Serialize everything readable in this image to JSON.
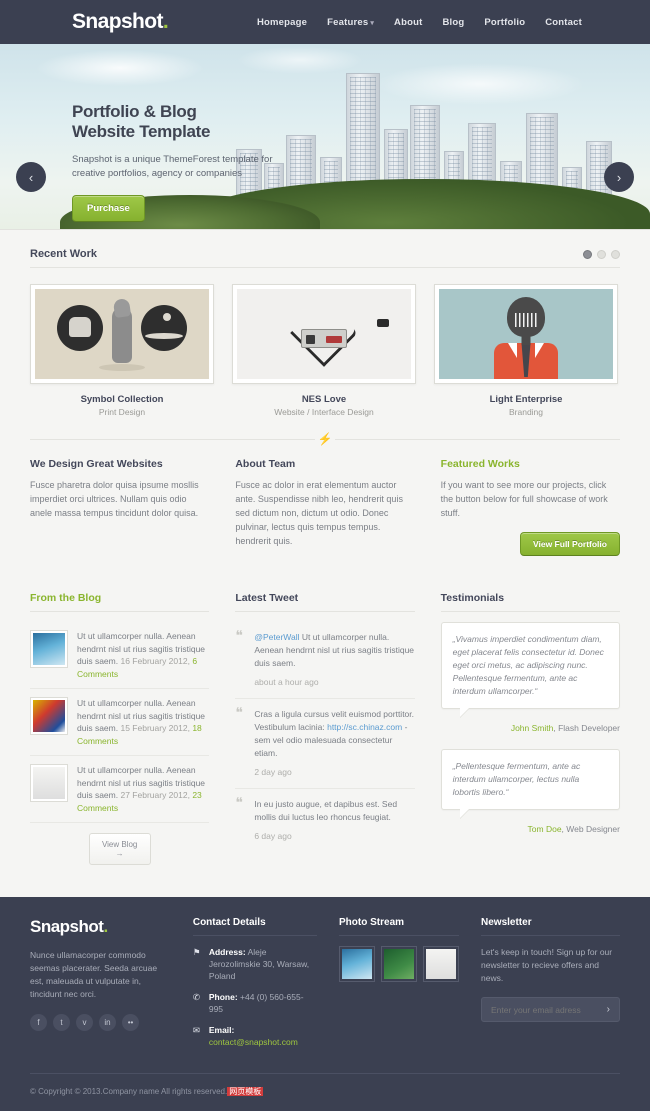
{
  "header": {
    "logo": "Snapshot",
    "logo_dot": ".",
    "nav": [
      {
        "label": "Homepage",
        "caret": ""
      },
      {
        "label": "Features",
        "caret": "▾"
      },
      {
        "label": "About",
        "caret": ""
      },
      {
        "label": "Blog",
        "caret": ""
      },
      {
        "label": "Portfolio",
        "caret": ""
      },
      {
        "label": "Contact",
        "caret": ""
      }
    ]
  },
  "hero": {
    "title_line1": "Portfolio & Blog",
    "title_line2": "Website Template",
    "paragraph": "Snapshot is a unique ThemeForest template for creative portfolios, agency or companies",
    "cta_label": "Purchase",
    "prev_icon": "‹",
    "next_icon": "›"
  },
  "recent_work": {
    "heading": "Recent Work",
    "pagination": [
      "active",
      "inactive",
      "inactive"
    ],
    "items": [
      {
        "title": "Symbol Collection",
        "subtitle": "Print Design"
      },
      {
        "title": "NES Love",
        "subtitle": "Website / Interface Design"
      },
      {
        "title": "Light Enterprise",
        "subtitle": "Branding"
      }
    ]
  },
  "divider_icon": "⚡",
  "columns": [
    {
      "heading": "We Design Great Websites",
      "body": "Fusce pharetra dolor quisa ipsume mosllis imperdiet orci ultrices. Nullam quis odio anele massa tempus tincidunt dolor quisa.",
      "button": ""
    },
    {
      "heading": "About Team",
      "body": "Fusce ac dolor in erat elementum auctor ante. Suspendisse nibh leo, hendrerit quis sed dictum non, dictum ut odio. Donec pulvinar, lectus quis tempus tempus. hendrerit quis.",
      "button": ""
    },
    {
      "heading": "Featured Works",
      "body": "If you want to see more our projects, click the button below for full showcase of work stuff.",
      "button": "View Full Portfolio"
    }
  ],
  "blog": {
    "heading": "From the Blog",
    "posts": [
      {
        "text": "Ut ut ullamcorper nulla. Aenean hendrnt nisl ut rius sagitis tristique duis saem.",
        "date": "16 February 2012,",
        "comments": "6 Comments"
      },
      {
        "text": "Ut ut ullamcorper nulla. Aenean hendrnt nisl ut rius sagitis tristique duis saem.",
        "date": "15 February 2012,",
        "comments": "18 Comments"
      },
      {
        "text": "Ut ut ullamcorper nulla. Aenean hendrnt nisl ut rius sagitis tristique duis saem.",
        "date": "27 February 2012,",
        "comments": "23 Comments"
      }
    ],
    "view_button": "View Blog →"
  },
  "tweets": {
    "heading": "Latest Tweet",
    "items": [
      {
        "handle": "@PeterWall",
        "text": " Ut ut ullamcorper nulla. Aenean hendrnt nisl ut rius sagitis tristique duis saem.",
        "link": "",
        "tail": "",
        "ago": "about a hour ago"
      },
      {
        "handle": "",
        "text": "Cras a ligula cursus velit euismod porttitor. Vestibulum lacinia: ",
        "link": "http://sc.chinaz.com",
        "tail": " - sem vel odio malesuada consectetur etiam.",
        "ago": "2 day ago"
      },
      {
        "handle": "",
        "text": "In eu justo augue, et dapibus est. Sed mollis dui luctus leo rhoncus feugiat.",
        "link": "",
        "tail": "",
        "ago": "6 day ago"
      }
    ]
  },
  "testimonials": {
    "heading": "Testimonials",
    "items": [
      {
        "quote": "„Vivamus imperdiet condimentum diam, eget placerat felis consectetur id. Donec eget orci metus, ac adipiscing nunc. Pellentesque fermentum, ante ac interdum ullamcorper.“",
        "author": "John Smith",
        "role": ", Flash Developer"
      },
      {
        "quote": "„Pellentesque fermentum, ante ac interdum ullamcorper, lectus nulla lobortis libero.“",
        "author": "Tom Doe",
        "role": ", Web Designer"
      }
    ]
  },
  "footer": {
    "logo": "Snapshot",
    "logo_dot": ".",
    "about": "Nunce ullamacorper commodo seemas placerater. Seeda arcuae est, maleuada ut vulputate in, tincidunt nec orci.",
    "socials": [
      {
        "name": "facebook-icon",
        "glyph": "f"
      },
      {
        "name": "twitter-icon",
        "glyph": "t"
      },
      {
        "name": "vimeo-icon",
        "glyph": "v"
      },
      {
        "name": "linkedin-icon",
        "glyph": "in"
      },
      {
        "name": "more-icon",
        "glyph": "••"
      }
    ],
    "contact": {
      "heading": "Contact Details",
      "rows": [
        {
          "icon": "⚑",
          "label": "Address:",
          "value": " Aleje Jerozolimskie 30, Warsaw, Poland",
          "link": ""
        },
        {
          "icon": "✆",
          "label": "Phone:",
          "value": " +44 (0) 560-655-995",
          "link": ""
        },
        {
          "icon": "✉",
          "label": "Email:",
          "value": "",
          "link": " contact@snapshot.com"
        }
      ]
    },
    "photostream": {
      "heading": "Photo Stream",
      "count": 3
    },
    "newsletter": {
      "heading": "Newsletter",
      "text": "Let's keep in touch! Sign up for our newsletter to recieve offers and news.",
      "placeholder": "Enter your email adress",
      "submit_icon": "›"
    },
    "copyright_pre": "© Copyright © 2013.Company name All rights reserved.",
    "copyright_cn": "网页模板"
  },
  "colors": {
    "dark": "#3b4051",
    "green": "#8ab52e",
    "bg": "#f5f5f3",
    "link_blue": "#5b9bd0"
  }
}
